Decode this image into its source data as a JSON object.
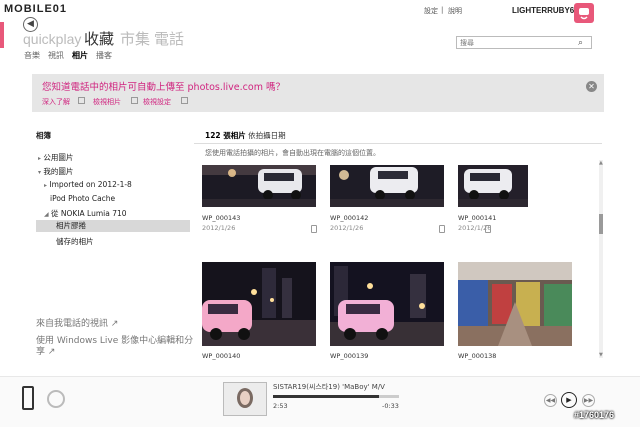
{
  "watermark_top": "MOBILE01",
  "watermark_bottom": "#1760176",
  "app": {
    "brand": "quickplay"
  },
  "nav": [
    {
      "label": "收藏",
      "active": true
    },
    {
      "label": "市集",
      "active": false
    },
    {
      "label": "電話",
      "active": false
    }
  ],
  "subnav": [
    {
      "label": "音樂",
      "active": false
    },
    {
      "label": "視訊",
      "active": false
    },
    {
      "label": "相片",
      "active": true
    },
    {
      "label": "播客",
      "active": false
    }
  ],
  "top_links": {
    "settings": "設定",
    "separator": "|",
    "help": "說明"
  },
  "user": {
    "name": "LIGHTERRUBY6"
  },
  "search": {
    "placeholder": "搜尋"
  },
  "banner": {
    "title": "您知道電話中的相片可自動上傳至 photos.live.com 嗎？",
    "links": [
      "深入了解",
      "檢視相片",
      "檢視設定"
    ]
  },
  "sidebar": {
    "heading": "相簿",
    "items": [
      {
        "label": "公用圖片",
        "caret": "▸"
      },
      {
        "label": "我的圖片",
        "caret": "▾"
      },
      {
        "label": "Imported on 2012-1-8",
        "caret": "▸"
      },
      {
        "label": "iPod Photo Cache",
        "caret": ""
      },
      {
        "label": "從 NOKIA Lumia 710",
        "caret": "◢"
      },
      {
        "label": "相片膠捲",
        "caret": "",
        "selected": true
      },
      {
        "label": "儲存的相片",
        "caret": ""
      }
    ],
    "links": [
      "來自我電話的視訊 ↗",
      "使用 Windows Live 影像中心編輯和分享 ↗"
    ]
  },
  "content": {
    "count": "122 張相片",
    "sort": "依拍攝日期",
    "hint": "您使用電話拍攝的相片，會自動出現在電腦的這個位置。",
    "photos": [
      {
        "name": "WP_000143",
        "date": "2012/1/26"
      },
      {
        "name": "WP_000142",
        "date": "2012/1/26"
      },
      {
        "name": "WP_000141",
        "date": "2012/1/26"
      },
      {
        "name": "WP_000140",
        "date": ""
      },
      {
        "name": "WP_000139",
        "date": ""
      },
      {
        "name": "WP_000138",
        "date": ""
      }
    ]
  },
  "player": {
    "title": "SISTAR19(씨스타19) 'MaBoy' M/V",
    "elapsed": "2:53",
    "remaining": "-0:33",
    "progress": 0.84,
    "prev_icon": "previous-icon",
    "play_icon": "play-icon",
    "next_icon": "next-icon"
  }
}
